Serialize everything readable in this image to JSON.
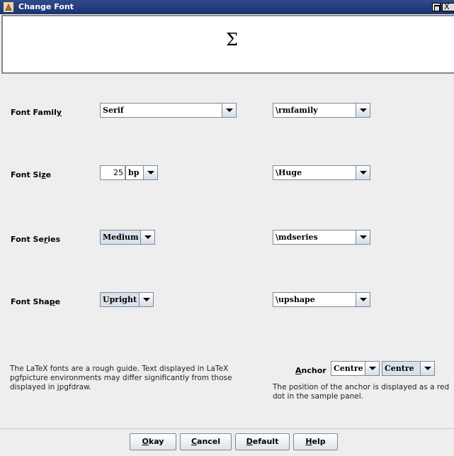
{
  "window": {
    "title": "Change Font",
    "close_glyph": "X"
  },
  "sample": {
    "symbol": "Σ"
  },
  "rows": [
    {
      "label_pre": "Font Famil",
      "label_mn": "y",
      "label_post": "",
      "value": "Serif",
      "latex": "\\rmfamily"
    },
    {
      "label_pre": "Font Si",
      "label_mn": "z",
      "label_post": "e",
      "value": "bp",
      "latex": "\\Huge"
    },
    {
      "label_pre": "Font Se",
      "label_mn": "r",
      "label_post": "ies",
      "value": "Medium",
      "latex": "\\mdseries"
    },
    {
      "label_pre": "Font Sha",
      "label_mn": "p",
      "label_post": "e",
      "value": "Upright",
      "latex": "\\upshape"
    }
  ],
  "size_value": "25",
  "note_left": "The LaTeX fonts are a rough guide. Text displayed in LaTeX pgfpicture environments may differ significantly from those displayed in jpgfdraw.",
  "anchor": {
    "label_mn": "A",
    "label_rest": "nchor",
    "horizontal": "Centre",
    "vertical": "Centre",
    "note": "The position of the anchor is displayed as a red dot in the sample panel."
  },
  "buttons": {
    "okay": {
      "mn": "O",
      "rest": "kay"
    },
    "cancel": {
      "mn": "C",
      "rest": "ancel"
    },
    "default": {
      "mn": "D",
      "rest": "efault"
    },
    "help": {
      "mn": "H",
      "rest": "elp"
    }
  }
}
